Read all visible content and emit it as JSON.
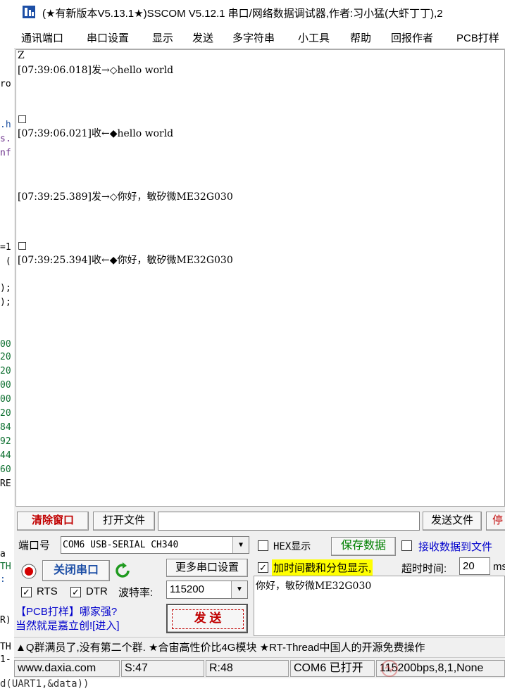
{
  "titlebar": {
    "title": "(★有新版本V5.13.1★)SSCOM V5.12.1 串口/网络数据调试器,作者:习小猛(大虾丁丁),2"
  },
  "menu": [
    "通讯端口",
    "串口设置",
    "显示",
    "发送",
    "多字符串",
    "小工具",
    "帮助",
    "回报作者",
    "PCB打样"
  ],
  "left_strip": [
    "ro",
    ".h",
    "s.",
    "nf",
    "=1",
    " (",
    ");",
    ");",
    "00",
    "20",
    "20",
    "00",
    "00",
    "20",
    "84",
    "92",
    "44",
    "60",
    "RE",
    "a",
    "TH",
    ":",
    "R)",
    "TH",
    "1-"
  ],
  "receive": {
    "lines": [
      "Z",
      "[07:39:06.018]发→◇hello world",
      "□",
      "[07:39:06.021]收←◆hello world",
      "[07:39:25.389]发→◇你好，敏矽微ME32G030",
      "□",
      "[07:39:25.394]收←◆你好，敏矽微ME32G030"
    ]
  },
  "toolbar": {
    "clear_label": "清除窗口",
    "open_file_label": "打开文件",
    "file_path": "",
    "send_file_label": "发送文件",
    "stop_label": "停"
  },
  "port": {
    "port_label": "端口号",
    "port_value": "COM6 USB-SERIAL CH340",
    "close_port_label": "关闭串口",
    "more_settings_label": "更多串口设置",
    "rts_label": "RTS",
    "dtr_label": "DTR",
    "baud_label": "波特率:",
    "baud_value": "115200"
  },
  "options": {
    "hex_display_label": "HEX显示",
    "save_data_label": "保存数据",
    "receive_to_file_label": "接收数据到文件",
    "timestamp_label": "加时间戳和分包显示,",
    "timeout_label": "超时时间:",
    "timeout_value": "20",
    "timeout_unit": "ms"
  },
  "send": {
    "text": "你好，敏矽微ME32G030",
    "send_button_label": "发 送"
  },
  "promo": {
    "line1": "【PCB打样】哪家强?",
    "line2": "当然就是嘉立创![进入]"
  },
  "ticker": "▲Q群满员了,没有第二个群. ★合宙高性价比4G模块 ★RT-Thread中国人的开源免费操作",
  "status": {
    "site": "www.daxia.com",
    "sent": "S:47",
    "received": "R:48",
    "port_state": "COM6 已打开",
    "params": "115200bps,8,1,None"
  },
  "bottom_code": "d(UART1,&data))",
  "watermark": "电子发烧友 bbs.elecfans.com",
  "colors": {
    "accent_red": "#c00000",
    "highlight_yellow": "#ffff00",
    "link_blue": "#0000cc",
    "green": "#008000"
  }
}
